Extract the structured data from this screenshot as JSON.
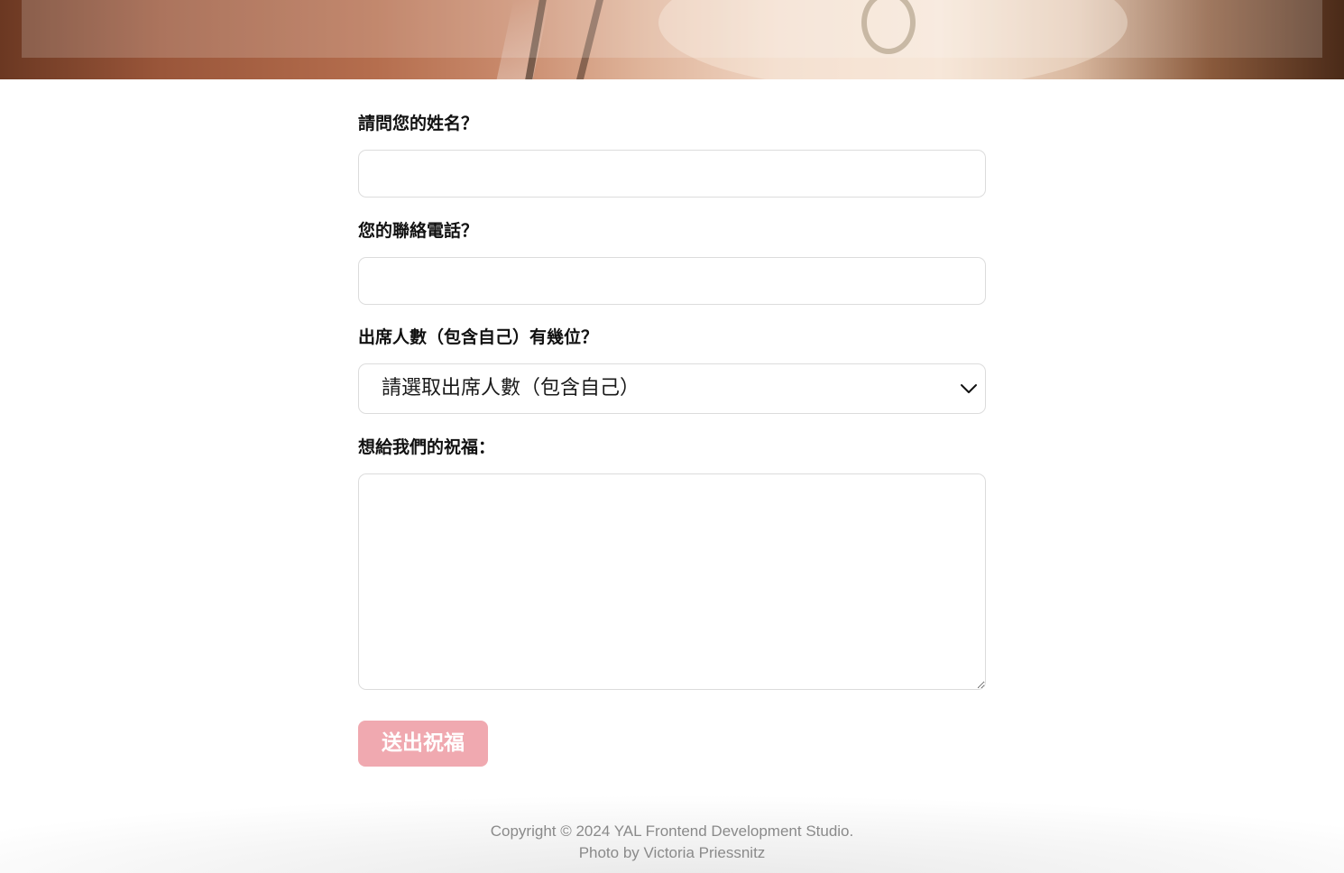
{
  "form": {
    "name_label": "請問您的姓名？",
    "name_value": "",
    "phone_label": "您的聯絡電話？",
    "phone_value": "",
    "attendees_label": "出席人數（包含自己）有幾位？",
    "attendees_selected": "請選取出席人數（包含自己）",
    "attendees_icon": "chevron-down-icon",
    "blessing_label": "想給我們的祝福：",
    "blessing_value": "",
    "submit_label": "送出祝福"
  },
  "footer": {
    "copyright": "Copyright © 2024 YAL Frontend Development Studio.",
    "photo_credit": "Photo by Victoria Priessnitz"
  },
  "colors": {
    "submit_bg": "#f0a9b0",
    "field_border": "#dcdcdc",
    "footer_text": "#8a8a8a"
  }
}
